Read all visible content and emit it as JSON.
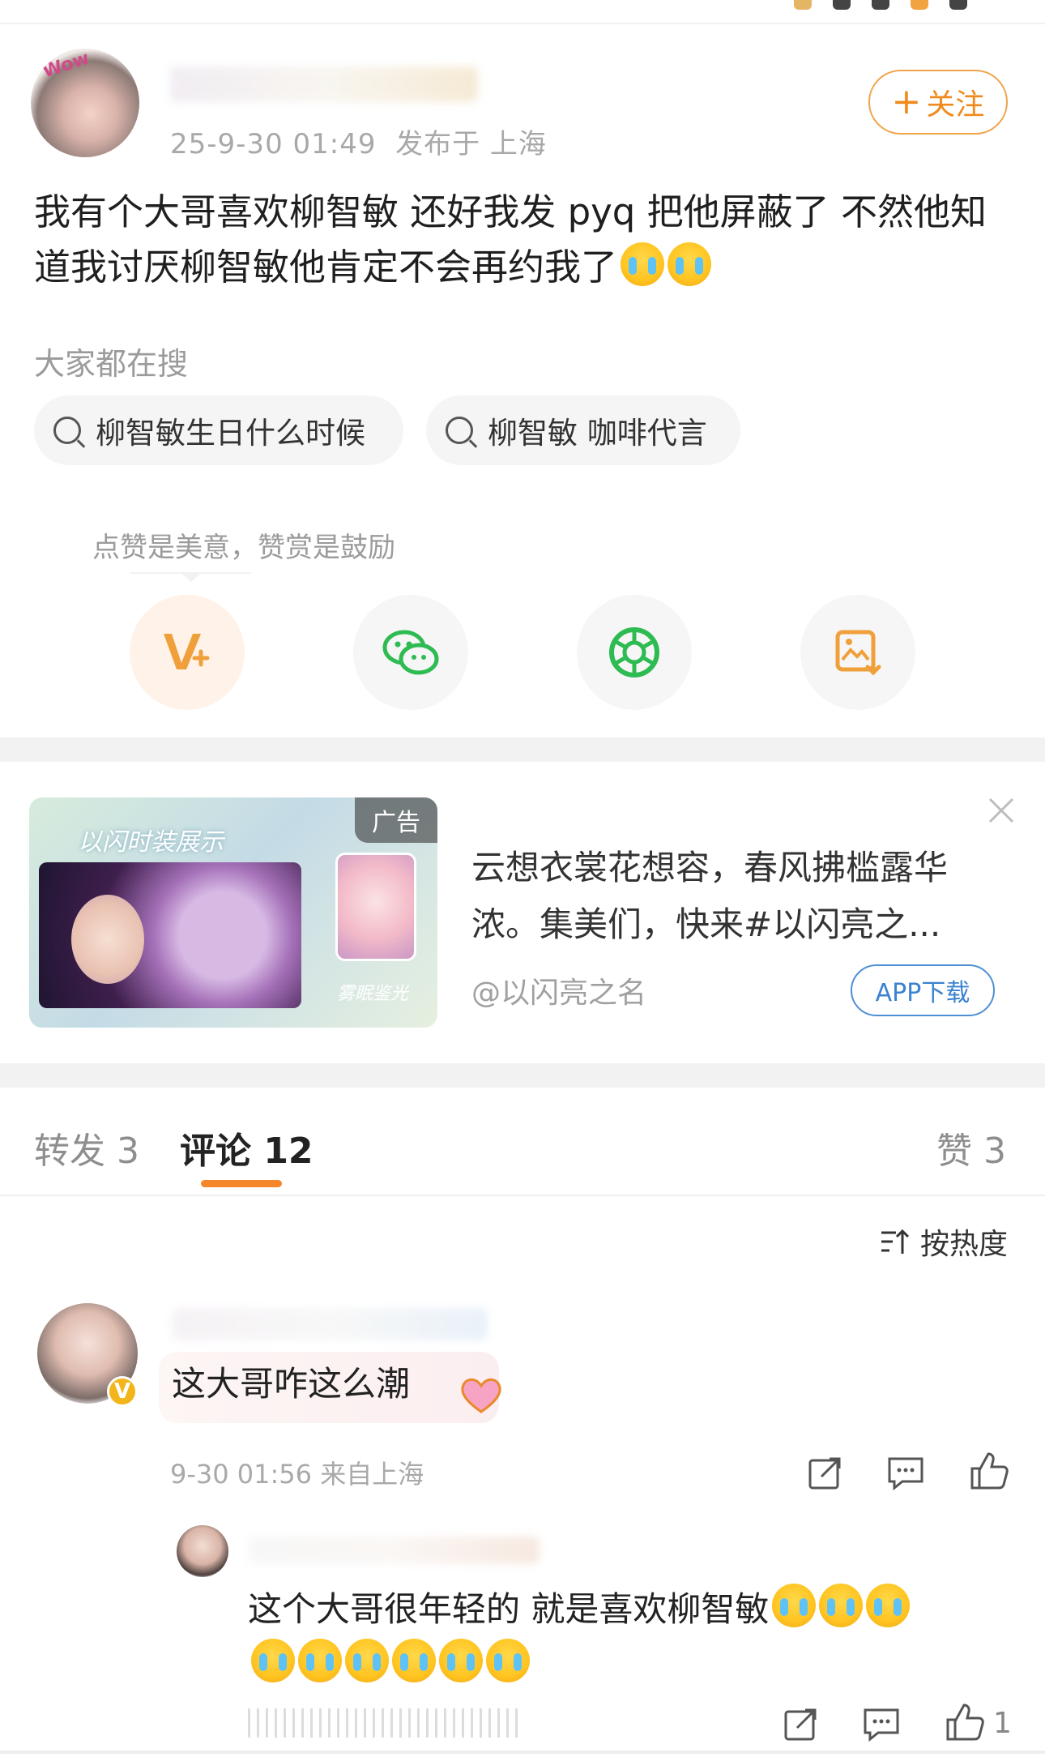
{
  "post": {
    "time": "25-9-30 01:49",
    "location": "发布于 上海",
    "follow_label": "关注",
    "text_1": "我有个大哥喜欢柳智敏 还好我发 pyq 把他屏蔽了 不然他知道我讨厌柳智敏他肯定不会再约我了",
    "emojis": [
      "crying-face",
      "crying-face"
    ]
  },
  "trending": {
    "title": "大家都在搜",
    "chips": [
      "柳智敏生日什么时候",
      "柳智敏 咖啡代言"
    ]
  },
  "reward": {
    "tip": "点赞是美意，赞赏是鼓励",
    "buttons": [
      "reward-icon",
      "wechat-icon",
      "moments-icon",
      "save-image-icon"
    ]
  },
  "ad": {
    "badge": "广告",
    "image_title": "以闪时装展示",
    "image_subtitle": "雾眠鉴光",
    "text": "云想衣裳花想容，春风拂槛露华浓。集美们，快来#以闪亮之...",
    "account": "@以闪亮之名",
    "download_label": "APP下载"
  },
  "tabs": {
    "repost": "转发 3",
    "comments": "评论 12",
    "likes": "赞 3",
    "sort_label": "按热度"
  },
  "comment": {
    "text": "这大哥咋这么潮",
    "meta": "9-30 01:56 来自上海",
    "badge": "V"
  },
  "reply": {
    "text": "这个大哥很年轻的 就是喜欢柳智敏",
    "emoji_count_line1": 3,
    "emoji_count_line2": 6,
    "like_count": "1"
  },
  "colors": {
    "accent_orange": "#f08a1c",
    "link_blue": "#3b82d0",
    "gray_text": "#9b9b9b"
  }
}
